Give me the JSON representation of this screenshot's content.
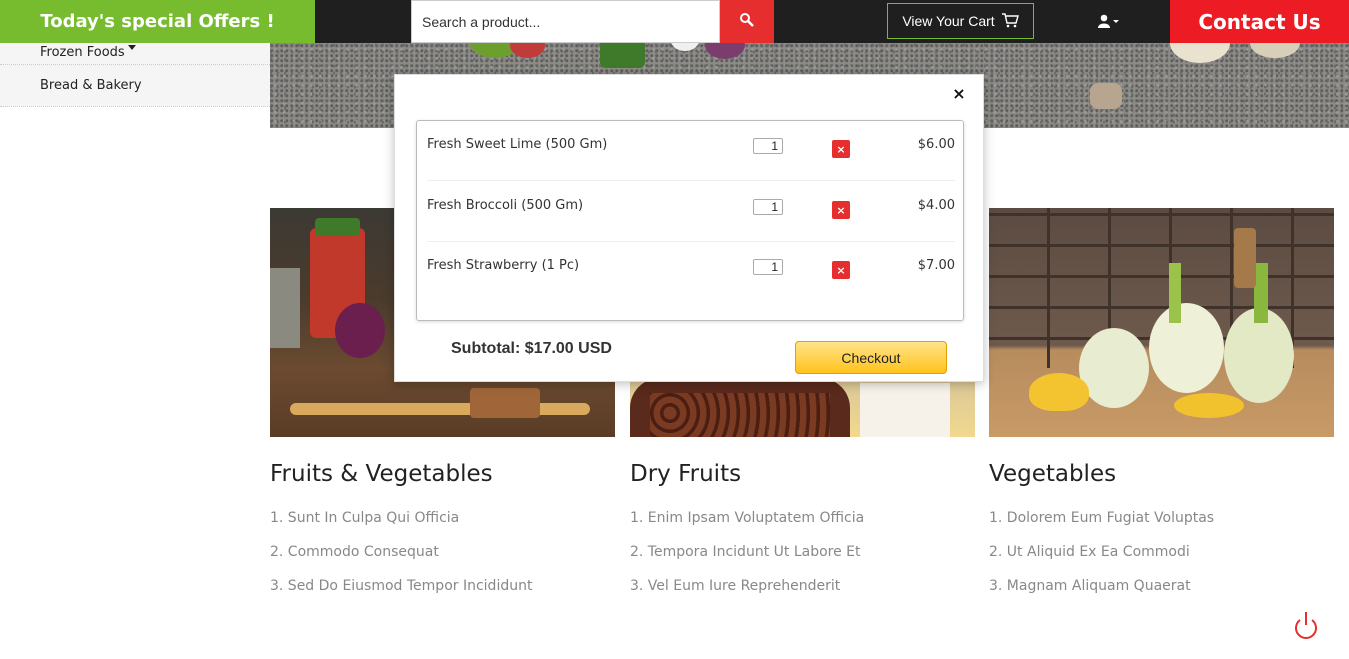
{
  "topbar": {
    "offers_label": "Today's special Offers !",
    "search_placeholder": "Search a product...",
    "search_icon": "search-icon",
    "cart_label": "View Your Cart",
    "cart_icon": "cart-icon",
    "user_icon": "user-icon",
    "contact_label": "Contact Us"
  },
  "sidebar": {
    "items": [
      {
        "label": "Frozen Foods"
      },
      {
        "label": "Bread & Bakery"
      }
    ]
  },
  "categories": [
    {
      "title": "Fruits & Vegetables",
      "items": [
        "1. Sunt In Culpa Qui Officia",
        "2. Commodo Consequat",
        "3. Sed Do Eiusmod Tempor Incididunt"
      ]
    },
    {
      "title": "Dry Fruits",
      "items": [
        "1. Enim Ipsam Voluptatem Officia",
        "2. Tempora Incidunt Ut Labore Et",
        "3. Vel Eum Iure Reprehenderit"
      ]
    },
    {
      "title": "Vegetables",
      "items": [
        "1. Dolorem Eum Fugiat Voluptas",
        "2. Ut Aliquid Ex Ea Commodi",
        "3. Magnam Aliquam Quaerat"
      ]
    }
  ],
  "cart": {
    "close_label": "×",
    "items": [
      {
        "name": "Fresh Sweet Lime (500 Gm)",
        "qty": "1",
        "remove": "×",
        "price": "$6.00"
      },
      {
        "name": "Fresh Broccoli (500 Gm)",
        "qty": "1",
        "remove": "×",
        "price": "$4.00"
      },
      {
        "name": "Fresh Strawberry (1 Pc)",
        "qty": "1",
        "remove": "×",
        "price": "$7.00"
      }
    ],
    "subtotal": "Subtotal: $17.00 USD",
    "checkout_label": "Checkout"
  },
  "colors": {
    "green": "#77bc2f",
    "red": "#ed1c24",
    "dark": "#1f1f1f"
  }
}
